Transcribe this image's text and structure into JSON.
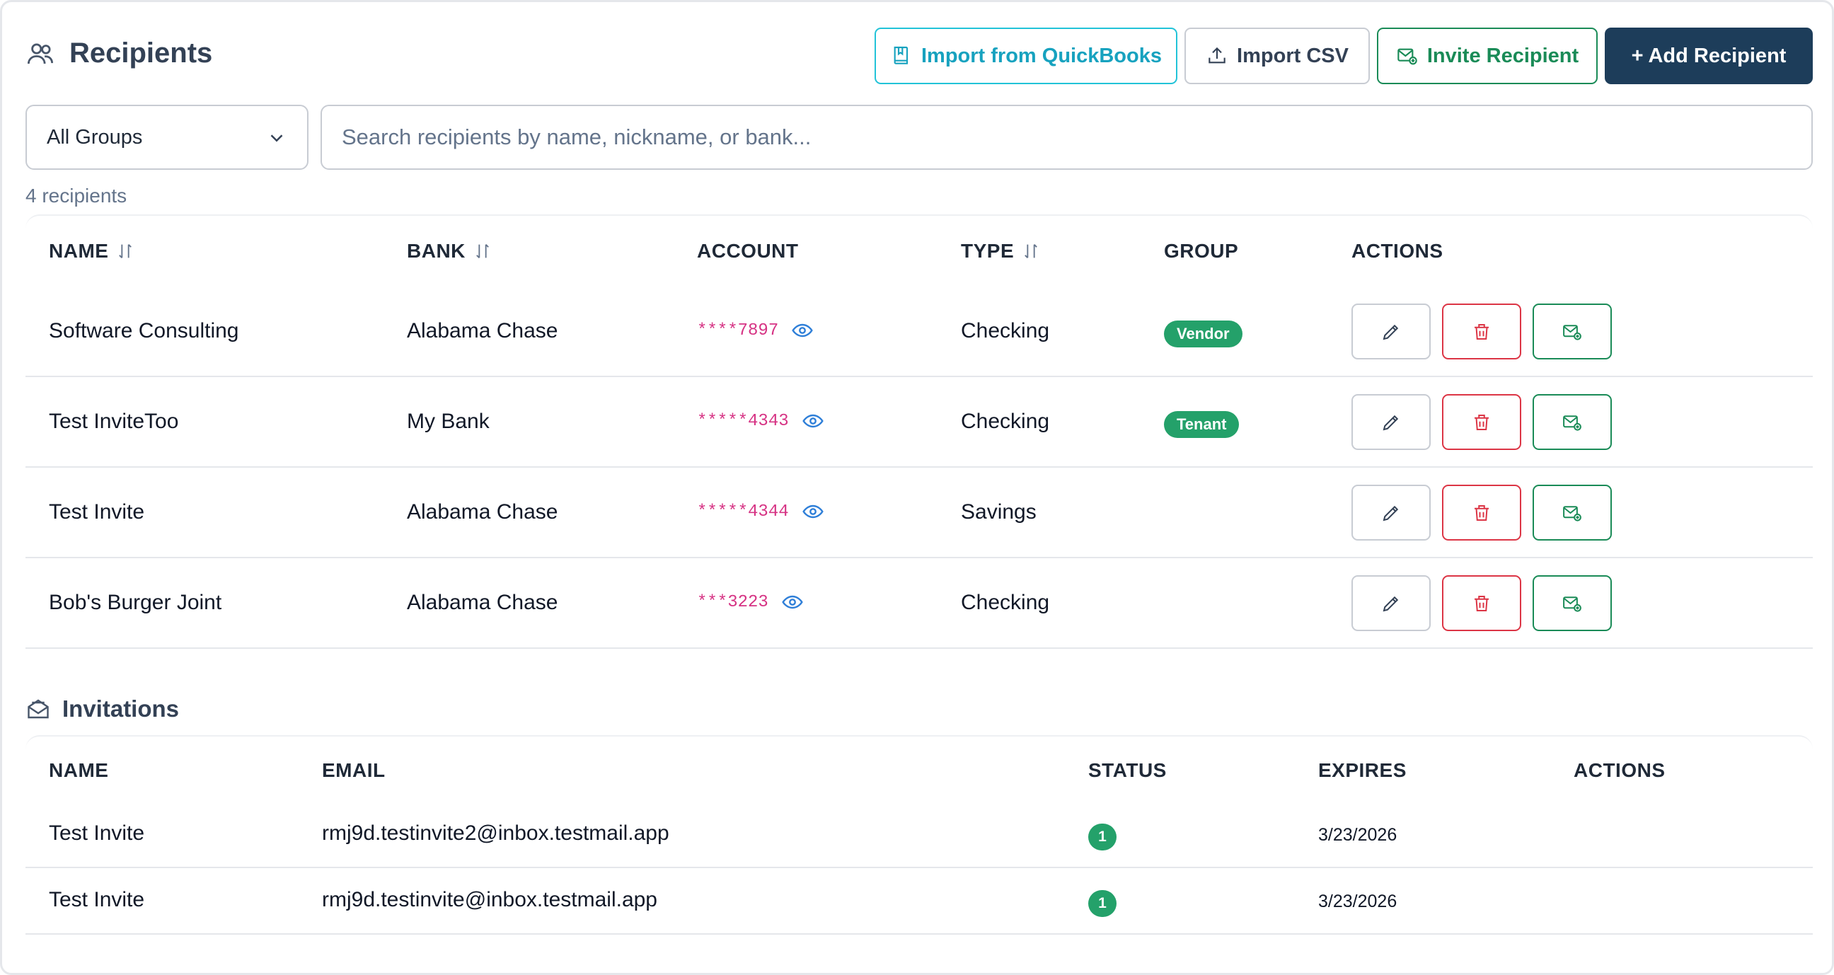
{
  "header": {
    "title": "Recipients",
    "title_icon": "users-icon",
    "buttons": {
      "import_qb": "Import from QuickBooks",
      "import_csv": "Import CSV",
      "invite": "Invite Recipient",
      "add": "+ Add Recipient"
    }
  },
  "filters": {
    "group_select": "All Groups",
    "search_placeholder": "Search recipients by name, nickname, or bank..."
  },
  "count_text": "4 recipients",
  "recipients_table": {
    "columns": [
      "NAME",
      "BANK",
      "ACCOUNT",
      "TYPE",
      "GROUP",
      "ACTIONS"
    ],
    "rows": [
      {
        "name": "Software Consulting",
        "bank": "Alabama Chase",
        "account": "****7897",
        "type": "Checking",
        "group": "Vendor"
      },
      {
        "name": "Test InviteToo",
        "bank": "My Bank",
        "account": "*****4343",
        "type": "Checking",
        "group": "Tenant"
      },
      {
        "name": "Test Invite",
        "bank": "Alabama Chase",
        "account": "*****4344",
        "type": "Savings",
        "group": ""
      },
      {
        "name": "Bob's Burger Joint",
        "bank": "Alabama Chase",
        "account": "***3223",
        "type": "Checking",
        "group": ""
      }
    ]
  },
  "invitations": {
    "title": "Invitations",
    "columns": [
      "NAME",
      "EMAIL",
      "STATUS",
      "EXPIRES",
      "ACTIONS"
    ],
    "rows": [
      {
        "name": "Test Invite",
        "email": "rmj9d.testinvite2@inbox.testmail.app",
        "status": "1",
        "expires": "3/23/2026"
      },
      {
        "name": "Test Invite",
        "email": "rmj9d.testinvite@inbox.testmail.app",
        "status": "1",
        "expires": "3/23/2026"
      }
    ]
  },
  "colors": {
    "primary_dark": "#1d3d5a",
    "success": "#1a8b57",
    "danger": "#dc3545",
    "info": "#17a2bf",
    "account_mask": "#d63384"
  }
}
